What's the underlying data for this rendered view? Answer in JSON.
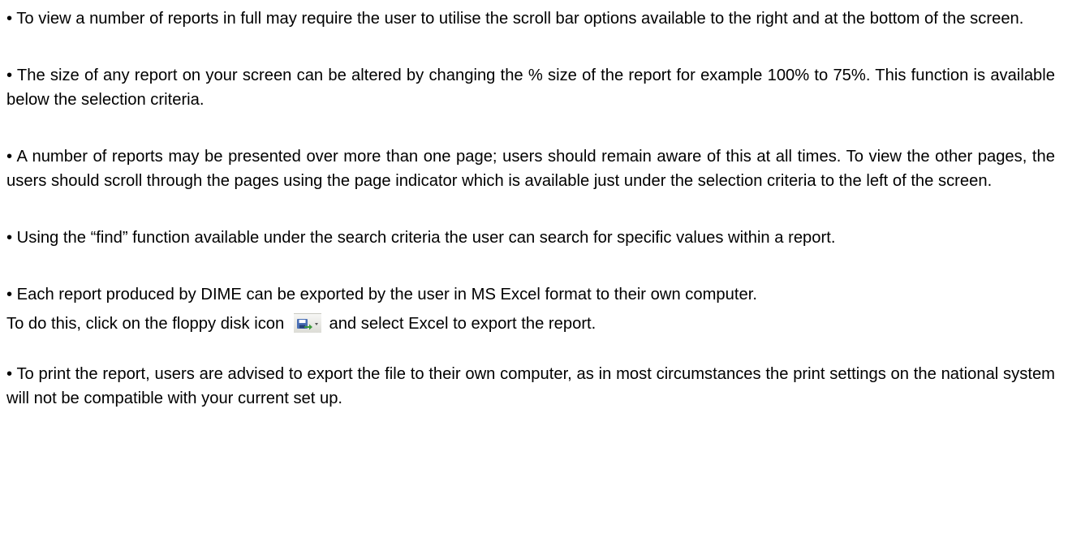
{
  "paragraphs": {
    "p1": "• To view a number of reports in full may require the user to utilise the scroll bar options available to the right and at the bottom of the screen.",
    "p2": "• The size of any report on your screen can be altered by changing the % size of the report for example 100% to 75%. This function is available below the selection criteria.",
    "p3": "• A number of reports may be presented over more than one page; users should remain aware of this at all times. To view the other pages, the users should scroll through the pages using the page indicator which is available just under the selection criteria to the left of the screen.",
    "p4": "• Using the “find” function available under the search criteria the user can search for specific values within a report.",
    "p5_line1": "• Each report produced by DIME can be exported by the user in MS Excel format to their own computer.",
    "p5_line2_before": "To do this, click on the floppy disk icon",
    "p5_line2_after": "and select Excel to export the report.",
    "p6": "• To print the report, users are advised to export the file to their own computer, as in most circumstances the print settings on the national system will not be compatible with your current set up."
  },
  "icons": {
    "export_icon": "floppy-disk-export-icon",
    "dropdown_icon": "chevron-down-icon"
  },
  "colors": {
    "text": "#000000",
    "background": "#ffffff",
    "floppy_disk": "#4a6fb5",
    "export_arrow": "#3c9a3c"
  }
}
